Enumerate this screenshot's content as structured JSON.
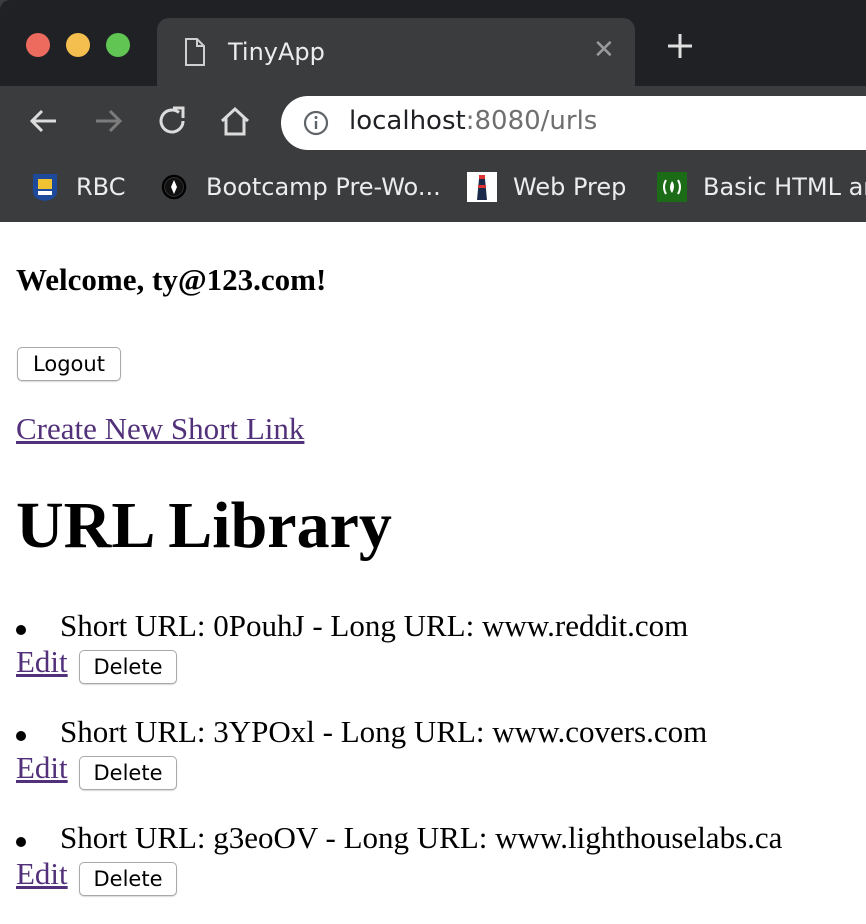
{
  "browser": {
    "tab_title": "TinyApp",
    "url_host": "localhost",
    "url_path": ":8080/urls",
    "bookmarks": [
      {
        "label": "RBC"
      },
      {
        "label": "Bootcamp Pre-Wo..."
      },
      {
        "label": "Web Prep"
      },
      {
        "label": "Basic HTML ar"
      }
    ],
    "colors": {
      "close": "#ed6a5e",
      "minimize": "#f5bf4f",
      "zoom": "#61c554"
    }
  },
  "page": {
    "welcome": "Welcome, ty@123.com!",
    "logout_label": "Logout",
    "create_link": "Create New Short Link",
    "library_title": "URL Library",
    "urls": [
      {
        "text": "Short URL: 0PouhJ - Long URL: www.reddit.com",
        "edit_label": "Edit",
        "delete_label": "Delete"
      },
      {
        "text": "Short URL: 3YPOxl - Long URL: www.covers.com",
        "edit_label": "Edit",
        "delete_label": "Delete"
      },
      {
        "text": "Short URL: g3eoOV - Long URL: www.lighthouselabs.ca",
        "edit_label": "Edit",
        "delete_label": "Delete"
      }
    ]
  }
}
